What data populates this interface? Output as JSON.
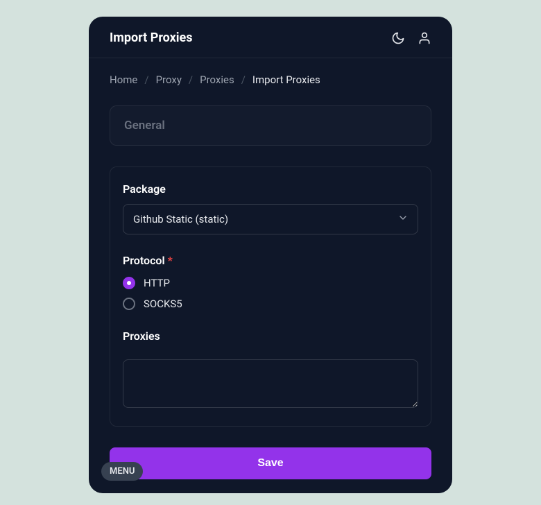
{
  "header": {
    "title": "Import Proxies"
  },
  "breadcrumb": {
    "items": [
      "Home",
      "Proxy",
      "Proxies"
    ],
    "current": "Import Proxies",
    "separator": "/"
  },
  "section": {
    "title": "General"
  },
  "form": {
    "package": {
      "label": "Package",
      "selected": "Github Static (static)"
    },
    "protocol": {
      "label": "Protocol",
      "required": true,
      "options": [
        {
          "label": "HTTP",
          "selected": true
        },
        {
          "label": "SOCKS5",
          "selected": false
        }
      ]
    },
    "proxies": {
      "label": "Proxies",
      "value": ""
    }
  },
  "actions": {
    "save": "Save",
    "menu": "MENU"
  },
  "required_mark": "*"
}
